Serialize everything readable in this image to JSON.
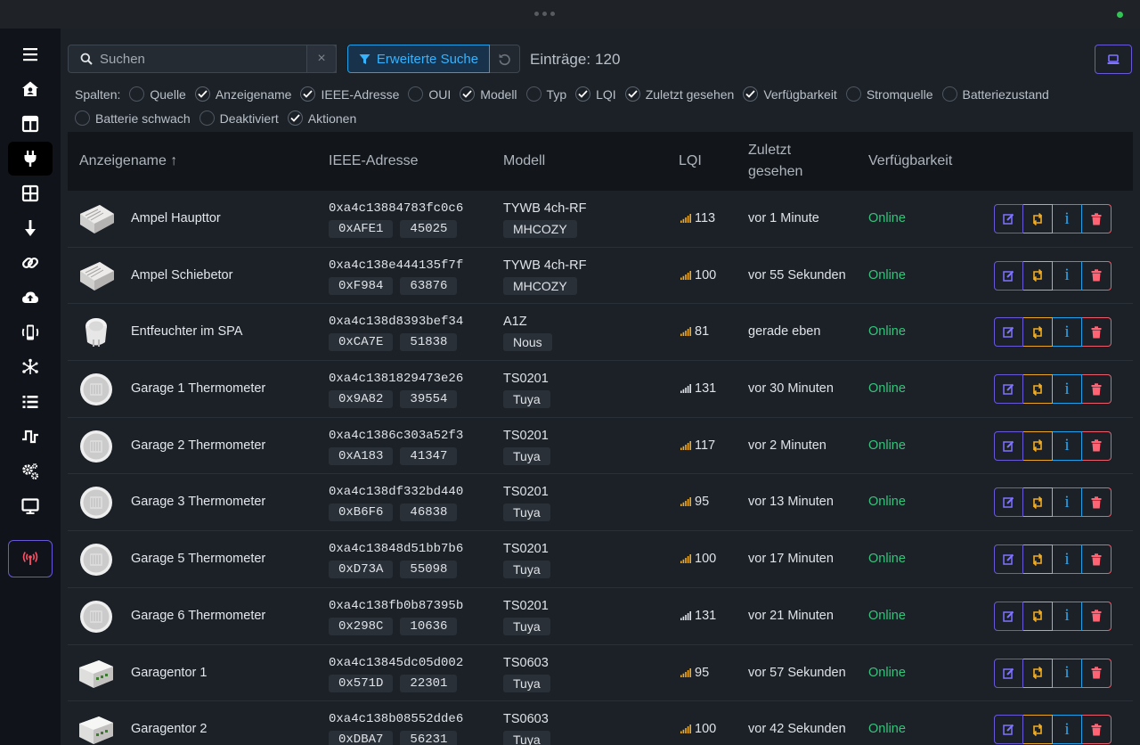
{
  "search": {
    "placeholder": "Suchen",
    "clear_icon": "×"
  },
  "toolbar": {
    "advanced_search_label": "Erweiterte Suche",
    "entries_label": "Einträge:",
    "entries_count": "120"
  },
  "columns": {
    "label": "Spalten:",
    "options": [
      {
        "label": "Quelle",
        "checked": false
      },
      {
        "label": "Anzeigename",
        "checked": true
      },
      {
        "label": "IEEE-Adresse",
        "checked": true
      },
      {
        "label": "OUI",
        "checked": false
      },
      {
        "label": "Modell",
        "checked": true
      },
      {
        "label": "Typ",
        "checked": false
      },
      {
        "label": "LQI",
        "checked": true
      },
      {
        "label": "Zuletzt gesehen",
        "checked": true
      },
      {
        "label": "Verfügbarkeit",
        "checked": true
      },
      {
        "label": "Stromquelle",
        "checked": false
      },
      {
        "label": "Batteriezustand",
        "checked": false
      },
      {
        "label": "Batterie schwach",
        "checked": false
      },
      {
        "label": "Deaktiviert",
        "checked": false
      },
      {
        "label": "Aktionen",
        "checked": true
      }
    ]
  },
  "table": {
    "headers": {
      "name": "Anzeigename ↑",
      "ieee": "IEEE-Adresse",
      "model": "Modell",
      "lqi": "LQI",
      "seen_line1": "Zuletzt",
      "seen_line2": "gesehen",
      "availability": "Verfügbarkeit"
    },
    "rows": [
      {
        "image": "switch-module",
        "name": "Ampel Haupttor",
        "ieee": "0xa4c13884783fc0c6",
        "nwk_hex": "0xAFE1",
        "nwk_dec": "45025",
        "model": "TYWB 4ch-RF",
        "vendor": "MHCOZY",
        "lqi": "113",
        "lqi_color": "#f1ac22",
        "seen": "vor 1 Minute",
        "availability": "Online"
      },
      {
        "image": "switch-module",
        "name": "Ampel Schiebetor",
        "ieee": "0xa4c138e444135f7f",
        "nwk_hex": "0xF984",
        "nwk_dec": "63876",
        "model": "TYWB 4ch-RF",
        "vendor": "MHCOZY",
        "lqi": "100",
        "lqi_color": "#f1ac22",
        "seen": "vor 55 Sekunden",
        "availability": "Online"
      },
      {
        "image": "plug",
        "name": "Entfeuchter im SPA",
        "ieee": "0xa4c138d8393bef34",
        "nwk_hex": "0xCA7E",
        "nwk_dec": "51838",
        "model": "A1Z",
        "vendor": "Nous",
        "lqi": "81",
        "lqi_color": "#f1ac22",
        "seen": "gerade eben",
        "availability": "Online"
      },
      {
        "image": "thermometer",
        "name": "Garage 1 Thermometer",
        "ieee": "0xa4c1381829473e26",
        "nwk_hex": "0x9A82",
        "nwk_dec": "39554",
        "model": "TS0201",
        "vendor": "Tuya",
        "lqi": "131",
        "lqi_color": "#dfe3e8",
        "seen": "vor 30 Minuten",
        "availability": "Online"
      },
      {
        "image": "thermometer",
        "name": "Garage 2 Thermometer",
        "ieee": "0xa4c1386c303a52f3",
        "nwk_hex": "0xA183",
        "nwk_dec": "41347",
        "model": "TS0201",
        "vendor": "Tuya",
        "lqi": "117",
        "lqi_color": "#f1ac22",
        "seen": "vor 2 Minuten",
        "availability": "Online"
      },
      {
        "image": "thermometer",
        "name": "Garage 3 Thermometer",
        "ieee": "0xa4c138df332bd440",
        "nwk_hex": "0xB6F6",
        "nwk_dec": "46838",
        "model": "TS0201",
        "vendor": "Tuya",
        "lqi": "95",
        "lqi_color": "#f1ac22",
        "seen": "vor 13 Minuten",
        "availability": "Online"
      },
      {
        "image": "thermometer",
        "name": "Garage 5 Thermometer",
        "ieee": "0xa4c13848d51bb7b6",
        "nwk_hex": "0xD73A",
        "nwk_dec": "55098",
        "model": "TS0201",
        "vendor": "Tuya",
        "lqi": "100",
        "lqi_color": "#f1ac22",
        "seen": "vor 17 Minuten",
        "availability": "Online"
      },
      {
        "image": "thermometer",
        "name": "Garage 6 Thermometer",
        "ieee": "0xa4c138fb0b87395b",
        "nwk_hex": "0x298C",
        "nwk_dec": "10636",
        "model": "TS0201",
        "vendor": "Tuya",
        "lqi": "131",
        "lqi_color": "#dfe3e8",
        "seen": "vor 21 Minuten",
        "availability": "Online"
      },
      {
        "image": "relay",
        "name": "Garagentor 1",
        "ieee": "0xa4c13845dc05d002",
        "nwk_hex": "0x571D",
        "nwk_dec": "22301",
        "model": "TS0603",
        "vendor": "Tuya",
        "lqi": "95",
        "lqi_color": "#f1ac22",
        "seen": "vor 57 Sekunden",
        "availability": "Online"
      },
      {
        "image": "relay",
        "name": "Garagentor 2",
        "ieee": "0xa4c138b08552dde6",
        "nwk_hex": "0xDBA7",
        "nwk_dec": "56231",
        "model": "TS0603",
        "vendor": "Tuya",
        "lqi": "100",
        "lqi_color": "#f1ac22",
        "seen": "vor 42 Sekunden",
        "availability": "Online"
      }
    ]
  },
  "colors": {
    "accent_purple": "#6758d8",
    "accent_blue": "#1fa0e9",
    "online_green": "#33c47a",
    "delete_red": "#ea5e6b",
    "swap_orange": "#e8a526"
  },
  "sidebar_icons": [
    "menu-icon",
    "home-icon",
    "dashboard-icon",
    "devices-icon",
    "groups-icon",
    "ota-icon",
    "bind-icon",
    "backup-icon",
    "touchlink-icon",
    "network-icon",
    "logs-icon",
    "frontend-icon",
    "settings-icon",
    "display-icon",
    "permit-join-icon"
  ]
}
